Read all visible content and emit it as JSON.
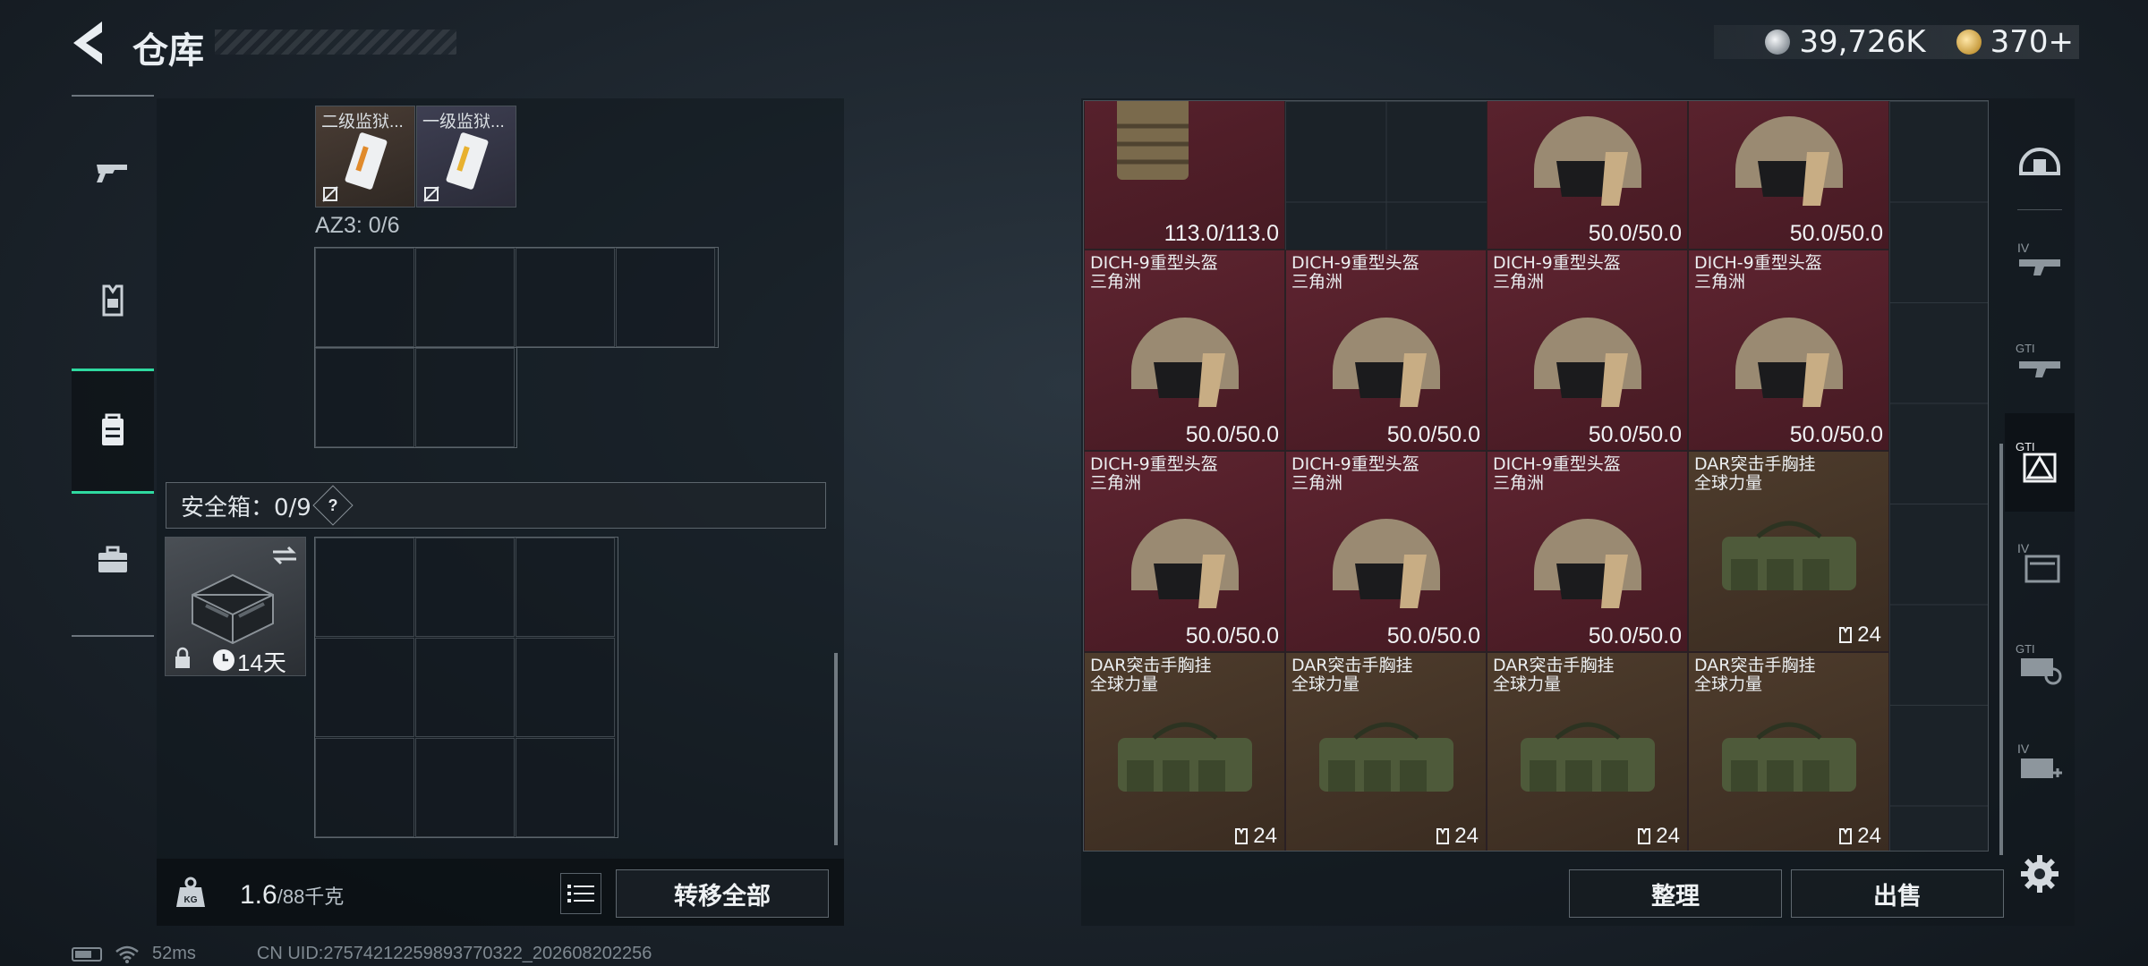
{
  "header": {
    "title": "仓库",
    "currency": [
      {
        "icon": "silver-coin-icon",
        "value": "39,726K"
      },
      {
        "icon": "gold-coin-icon",
        "value": "370+"
      }
    ]
  },
  "left_nav": {
    "items": [
      {
        "icon": "gun-icon",
        "active": false
      },
      {
        "icon": "vest-icon",
        "active": false
      },
      {
        "icon": "backpack-icon",
        "active": true
      },
      {
        "icon": "briefcase-icon",
        "active": false
      }
    ]
  },
  "loadout": {
    "top_items": [
      {
        "label": "二级监狱..."
      },
      {
        "label": "一级监狱..."
      }
    ],
    "az3_label": "AZ3: 0/6",
    "safebox_label": "安全箱：0/9",
    "safebox_help": "?",
    "safebox_duration": "14天",
    "weight": {
      "current": "1.6",
      "max": "/88千克"
    },
    "transfer_all_label": "转移全部"
  },
  "stash": {
    "top_row_durability": [
      "113.0/113.0",
      "50.0/50.0",
      "50.0/50.0"
    ],
    "items": [
      {
        "name1": "DICH-9重型头盔",
        "name2": "三角洲",
        "value": "50.0/50.0",
        "type": "helmet"
      },
      {
        "name1": "DICH-9重型头盔",
        "name2": "三角洲",
        "value": "50.0/50.0",
        "type": "helmet"
      },
      {
        "name1": "DICH-9重型头盔",
        "name2": "三角洲",
        "value": "50.0/50.0",
        "type": "helmet"
      },
      {
        "name1": "DICH-9重型头盔",
        "name2": "三角洲",
        "value": "50.0/50.0",
        "type": "helmet"
      },
      {
        "name1": "DICH-9重型头盔",
        "name2": "三角洲",
        "value": "50.0/50.0",
        "type": "helmet"
      },
      {
        "name1": "DICH-9重型头盔",
        "name2": "三角洲",
        "value": "50.0/50.0",
        "type": "helmet"
      },
      {
        "name1": "DICH-9重型头盔",
        "name2": "三角洲",
        "value": "50.0/50.0",
        "type": "helmet"
      },
      {
        "name1": "DAR突击手胸挂",
        "name2": "全球力量",
        "value": "24",
        "type": "rig"
      },
      {
        "name1": "DAR突击手胸挂",
        "name2": "全球力量",
        "value": "24",
        "type": "rig"
      },
      {
        "name1": "DAR突击手胸挂",
        "name2": "全球力量",
        "value": "24",
        "type": "rig"
      },
      {
        "name1": "DAR突击手胸挂",
        "name2": "全球力量",
        "value": "24",
        "type": "rig"
      },
      {
        "name1": "DAR突击手胸挂",
        "name2": "全球力量",
        "value": "24",
        "type": "rig"
      }
    ],
    "sort_label": "整理",
    "sell_label": "出售"
  },
  "right_nav": {
    "items": [
      {
        "icon": "helmet-category-icon",
        "badge": ""
      },
      {
        "icon": "rifle-iv-icon",
        "badge": "IV"
      },
      {
        "icon": "rifle-gti-icon",
        "badge": "GTI"
      },
      {
        "icon": "gti-warning-icon",
        "badge": "GTI",
        "active": true
      },
      {
        "icon": "iv-card-icon",
        "badge": "IV"
      },
      {
        "icon": "gti-gear-icon",
        "badge": "GTI"
      },
      {
        "icon": "iv-medkit-icon",
        "badge": "IV"
      }
    ]
  },
  "status_bar": {
    "ping": "52ms",
    "uid": "CN UID:27574212259893770322_202608202256"
  },
  "colors": {
    "accent": "#2fd9a0",
    "helmet_bg": "#5e2430",
    "rig_bg": "#4e3c2c"
  }
}
